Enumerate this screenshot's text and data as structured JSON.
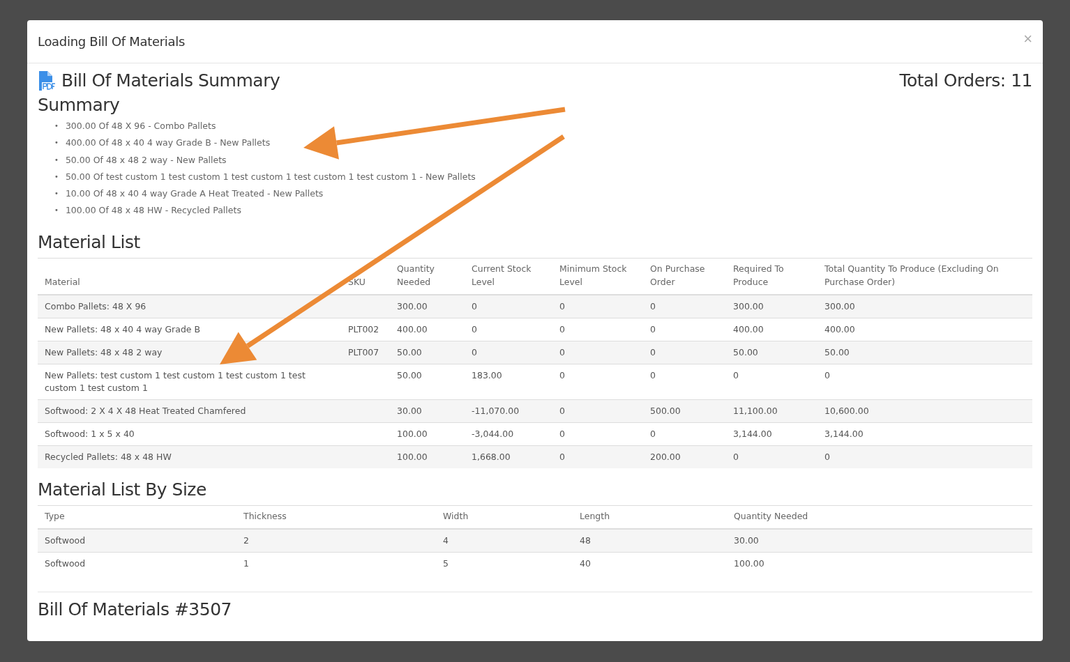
{
  "modal": {
    "title": "Loading Bill Of Materials",
    "close": "×"
  },
  "report": {
    "title": "Bill Of Materials Summary",
    "total_orders_label": "Total Orders:",
    "total_orders": "11"
  },
  "summary": {
    "heading": "Summary",
    "marker": "•",
    "items": [
      "300.00 Of 48 X 96 - Combo Pallets",
      "400.00 Of 48 x 40 4 way Grade B - New Pallets",
      "50.00 Of 48 x 48 2 way - New Pallets",
      "50.00 Of test custom 1 test custom 1 test custom 1 test custom 1 test custom 1 - New Pallets",
      "10.00 Of 48 x 40 4 way Grade A Heat Treated - New Pallets",
      "100.00 Of 48 x 48 HW - Recycled Pallets"
    ]
  },
  "material_list": {
    "heading": "Material List",
    "columns": [
      "Material",
      "SKU",
      "Quantity Needed",
      "Current Stock Level",
      "Minimum Stock Level",
      "On Purchase Order",
      "Required To Produce",
      "Total Quantity To Produce (Excluding On Purchase Order)"
    ],
    "rows": [
      [
        "Combo Pallets: 48 X 96",
        "",
        "300.00",
        "0",
        "0",
        "0",
        "300.00",
        "300.00"
      ],
      [
        "New Pallets: 48 x 40 4 way Grade B",
        "PLT002",
        "400.00",
        "0",
        "0",
        "0",
        "400.00",
        "400.00"
      ],
      [
        "New Pallets: 48 x 48 2 way",
        "PLT007",
        "50.00",
        "0",
        "0",
        "0",
        "50.00",
        "50.00"
      ],
      [
        "New Pallets: test custom 1 test custom 1 test custom 1 test custom 1 test custom 1",
        "",
        "50.00",
        "183.00",
        "0",
        "0",
        "0",
        "0"
      ],
      [
        "Softwood: 2 X 4 X 48 Heat Treated Chamfered",
        "",
        "30.00",
        "-11,070.00",
        "0",
        "500.00",
        "11,100.00",
        "10,600.00"
      ],
      [
        "Softwood: 1 x 5 x 40",
        "",
        "100.00",
        "-3,044.00",
        "0",
        "0",
        "3,144.00",
        "3,144.00"
      ],
      [
        "Recycled Pallets: 48 x 48 HW",
        "",
        "100.00",
        "1,668.00",
        "0",
        "200.00",
        "0",
        "0"
      ]
    ]
  },
  "material_list_by_size": {
    "heading": "Material List By Size",
    "columns": [
      "Type",
      "Thickness",
      "Width",
      "Length",
      "Quantity Needed"
    ],
    "rows": [
      [
        "Softwood",
        "2",
        "4",
        "48",
        "30.00"
      ],
      [
        "Softwood",
        "1",
        "5",
        "40",
        "100.00"
      ]
    ]
  },
  "next_section": {
    "heading": "Bill Of Materials #3507"
  }
}
